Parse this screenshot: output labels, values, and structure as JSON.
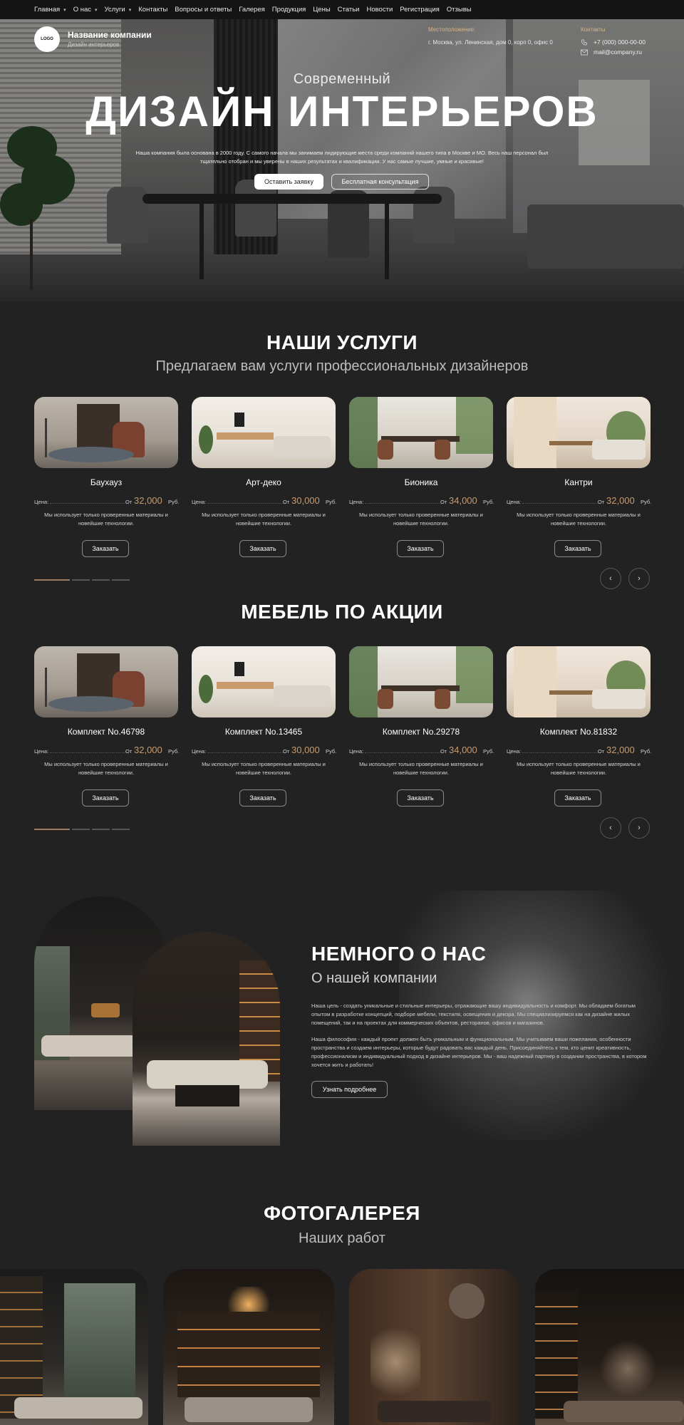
{
  "nav": {
    "items": [
      {
        "label": "Главная",
        "dropdown": true
      },
      {
        "label": "О нас",
        "dropdown": true
      },
      {
        "label": "Услуги",
        "dropdown": true
      },
      {
        "label": "Контакты",
        "dropdown": false
      },
      {
        "label": "Вопросы и ответы",
        "dropdown": false
      },
      {
        "label": "Галерея",
        "dropdown": false
      },
      {
        "label": "Продукция",
        "dropdown": false
      },
      {
        "label": "Цены",
        "dropdown": false
      },
      {
        "label": "Статьи",
        "dropdown": false
      },
      {
        "label": "Новости",
        "dropdown": false
      },
      {
        "label": "Регистрация",
        "dropdown": false
      },
      {
        "label": "Отзывы",
        "dropdown": false
      }
    ]
  },
  "header": {
    "logo_text": "LOGO",
    "company_name": "Название компании",
    "company_sub": "Дизайн интерьеров",
    "location_label": "Местоположение:",
    "location_value": "г. Москва, ул. Ленинская, дом 0, корп 0, офис 0",
    "contacts_label": "Контакты",
    "phone": "+7 (000) 000-00-00",
    "email": "mail@company.ru"
  },
  "hero": {
    "kicker": "Современный",
    "title": "ДИЗАЙН ИНТЕРЬЕРОВ",
    "text": "Наша компания была основана в 2000 году. С самого начала мы занимаем лидирующие места среди компаний нашего типа в Москве и МО. Весь наш персонал был тщательно отобран и мы уверены в наших результатах и квалификации. У нас самые лучшие, умные и красивые!",
    "btn_primary": "Оставить заявку",
    "btn_secondary": "Бесплатная консультация"
  },
  "services": {
    "title": "НАШИ УСЛУГИ",
    "subtitle": "Предлагаем вам услуги профессиональных дизайнеров",
    "cards": [
      {
        "name": "Баухауз",
        "price_label": "Цена:",
        "from": "От",
        "price": "32,000",
        "currency": "Руб.",
        "desc": "Мы использует только проверенные материалы и новейшие технологии.",
        "button": "Заказать"
      },
      {
        "name": "Арт-деко",
        "price_label": "Цена:",
        "from": "От",
        "price": "30,000",
        "currency": "Руб.",
        "desc": "Мы использует только проверенные материалы и новейшие технологии.",
        "button": "Заказать"
      },
      {
        "name": "Бионика",
        "price_label": "Цена:",
        "from": "От",
        "price": "34,000",
        "currency": "Руб.",
        "desc": "Мы использует только проверенные материалы и новейшие технологии.",
        "button": "Заказать"
      },
      {
        "name": "Кантри",
        "price_label": "Цена:",
        "from": "От",
        "price": "32,000",
        "currency": "Руб.",
        "desc": "Мы использует только проверенные материалы и новейшие технологии.",
        "button": "Заказать"
      }
    ],
    "prev_arrow": "‹",
    "next_arrow": "›"
  },
  "promo": {
    "title": "МЕБЕЛЬ ПО АКЦИИ",
    "cards": [
      {
        "name": "Комплект No.46798",
        "price_label": "Цена:",
        "from": "От",
        "price": "32,000",
        "currency": "Руб.",
        "desc": "Мы использует только проверенные материалы и новейшие технологии.",
        "button": "Заказать"
      },
      {
        "name": "Комплект No.13465",
        "price_label": "Цена:",
        "from": "От",
        "price": "30,000",
        "currency": "Руб.",
        "desc": "Мы использует только проверенные материалы и новейшие технологии.",
        "button": "Заказать"
      },
      {
        "name": "Комплект No.29278",
        "price_label": "Цена:",
        "from": "От",
        "price": "34,000",
        "currency": "Руб.",
        "desc": "Мы использует только проверенные материалы и новейшие технологии.",
        "button": "Заказать"
      },
      {
        "name": "Комплект No.81832",
        "price_label": "Цена:",
        "from": "От",
        "price": "32,000",
        "currency": "Руб.",
        "desc": "Мы использует только проверенные материалы и новейшие технологии.",
        "button": "Заказать"
      }
    ],
    "prev_arrow": "‹",
    "next_arrow": "›"
  },
  "about": {
    "title": "НЕМНОГО О НАС",
    "subtitle": "О нашей компании",
    "p1": "Наша цель - создать уникальные и стильные интерьеры, отражающие вашу индивидуальность и комфорт. Мы обладаем богатым опытом в разработке концепций, подборе мебели, текстиля, освещения и декора. Мы специализируемся как на дизайне жилых помещений, так и на проектах для коммерческих объектов, ресторанов, офисов и магазинов.",
    "p2": "Наша философия - каждый проект должен быть уникальным и функциональным. Мы учитываем ваши пожелания, особенности пространства и создаем интерьеры, которые будут радовать вас каждый день. Присоединяйтесь к тем, кто ценит креативность, профессионализм и индивидуальный подход в дизайне интерьеров. Мы - ваш надежный партнер в создании пространства, в котором хочется жить и работать!",
    "button": "Узнать подробнее"
  },
  "gallery": {
    "title": "ФОТОГАЛЕРЕЯ",
    "subtitle": "Наших работ"
  },
  "colors": {
    "background": "#222222",
    "accent_price": "#c79c6e",
    "accent_label": "#d6b48c"
  }
}
